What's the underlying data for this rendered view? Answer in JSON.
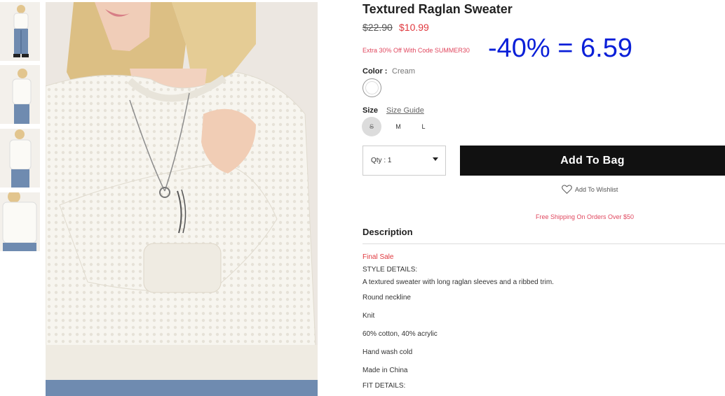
{
  "product": {
    "title": "Textured Raglan Sweater",
    "original_price": "$22.90",
    "sale_price": "$10.99",
    "promo_text": "Extra 30% Off With Code SUMMER30",
    "annotation": "-40% = 6.59"
  },
  "color": {
    "label": "Color",
    "separator": ":",
    "value": "Cream",
    "swatch_hex": "#ffffff"
  },
  "size": {
    "label": "Size",
    "guide_link": "Size Guide",
    "options": [
      "S",
      "M",
      "L"
    ],
    "unavailable": [
      "S"
    ]
  },
  "quantity": {
    "label": "Qty : 1"
  },
  "actions": {
    "add_to_bag": "Add To Bag",
    "add_to_wishlist": "Add To Wishlist"
  },
  "shipping_notice": "Free Shipping On Orders Over $50",
  "description": {
    "heading": "Description",
    "lines": [
      "Final Sale",
      "STYLE DETAILS:",
      "A textured sweater with long raglan sleeves and a ribbed trim.",
      "Round neckline",
      "Knit",
      "60% cotton, 40% acrylic",
      "Hand wash cold",
      "Made in China",
      "FIT DETAILS:"
    ]
  },
  "colors": {
    "accent_red": "#e0383e",
    "promo_pink": "#e0475e",
    "annotation_blue": "#0a1fd8",
    "button_black": "#111111"
  }
}
